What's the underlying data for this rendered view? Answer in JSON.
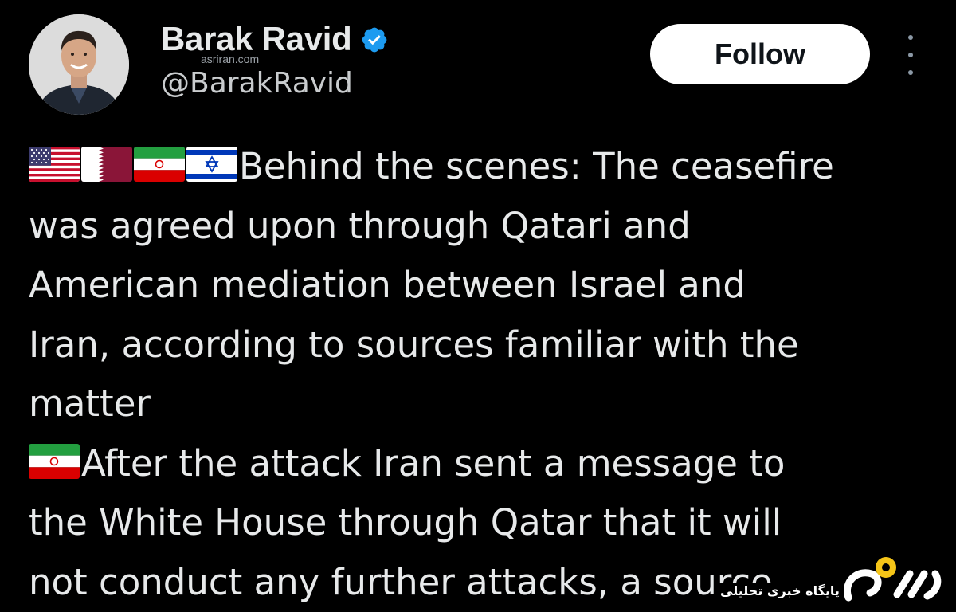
{
  "author": {
    "name": "Barak Ravid",
    "handle": "@BarakRavid",
    "verified": true,
    "avatar_icon": "profile-photo"
  },
  "watermark": {
    "site": "asriran.com",
    "logo_tagline": "پایگاه خبری تحلیلی"
  },
  "actions": {
    "follow_label": "Follow",
    "more_icon": "more-vertical-icon"
  },
  "colors": {
    "background": "#000000",
    "text": "#e7e9ea",
    "verified_badge": "#1d9bf0",
    "follow_bg": "#ffffff",
    "logo_accent": "#f5c518"
  },
  "tweet": {
    "lines": [
      "Behind the scenes: The ceasefire",
      "was agreed upon through Qatari and",
      "American mediation between Israel and",
      "Iran, according to sources familiar with the",
      "matter",
      "After the attack Iran sent a message to",
      "the White House through Qatar that it will",
      "not conduct any further attacks, a source"
    ],
    "flags_line1": [
      "us-flag",
      "qatar-flag",
      "iran-flag",
      "israel-flag"
    ],
    "flags_line6": [
      "iran-flag"
    ]
  }
}
